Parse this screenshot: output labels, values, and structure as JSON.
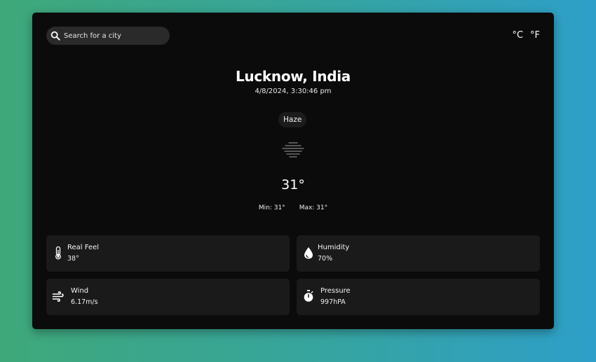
{
  "search": {
    "placeholder": "Search for a city"
  },
  "units": {
    "celsius": "°C",
    "fahrenheit": "°F"
  },
  "location": {
    "city": "Lucknow, India",
    "datetime": "4/8/2024, 3:30:46 pm"
  },
  "weather": {
    "condition": "Haze",
    "icon": "haze-icon",
    "temperature": "31°",
    "min": "Min: 31°",
    "max": "Max: 31°"
  },
  "details": [
    {
      "label": "Real Feel",
      "value": "38°",
      "icon": "thermometer-icon"
    },
    {
      "label": "Humidity",
      "value": "70%",
      "icon": "water-drop-icon"
    },
    {
      "label": "Wind",
      "value": "6.17m/s",
      "icon": "wind-icon"
    },
    {
      "label": "Pressure",
      "value": "997hPA",
      "icon": "stopwatch-icon"
    }
  ],
  "colors": {
    "card_background": "#0b0b0b",
    "tile_background": "#1a1a1a",
    "search_background": "#2a2a2a",
    "gradient_left": "#3fa87a",
    "gradient_right": "#2e9fc9"
  }
}
